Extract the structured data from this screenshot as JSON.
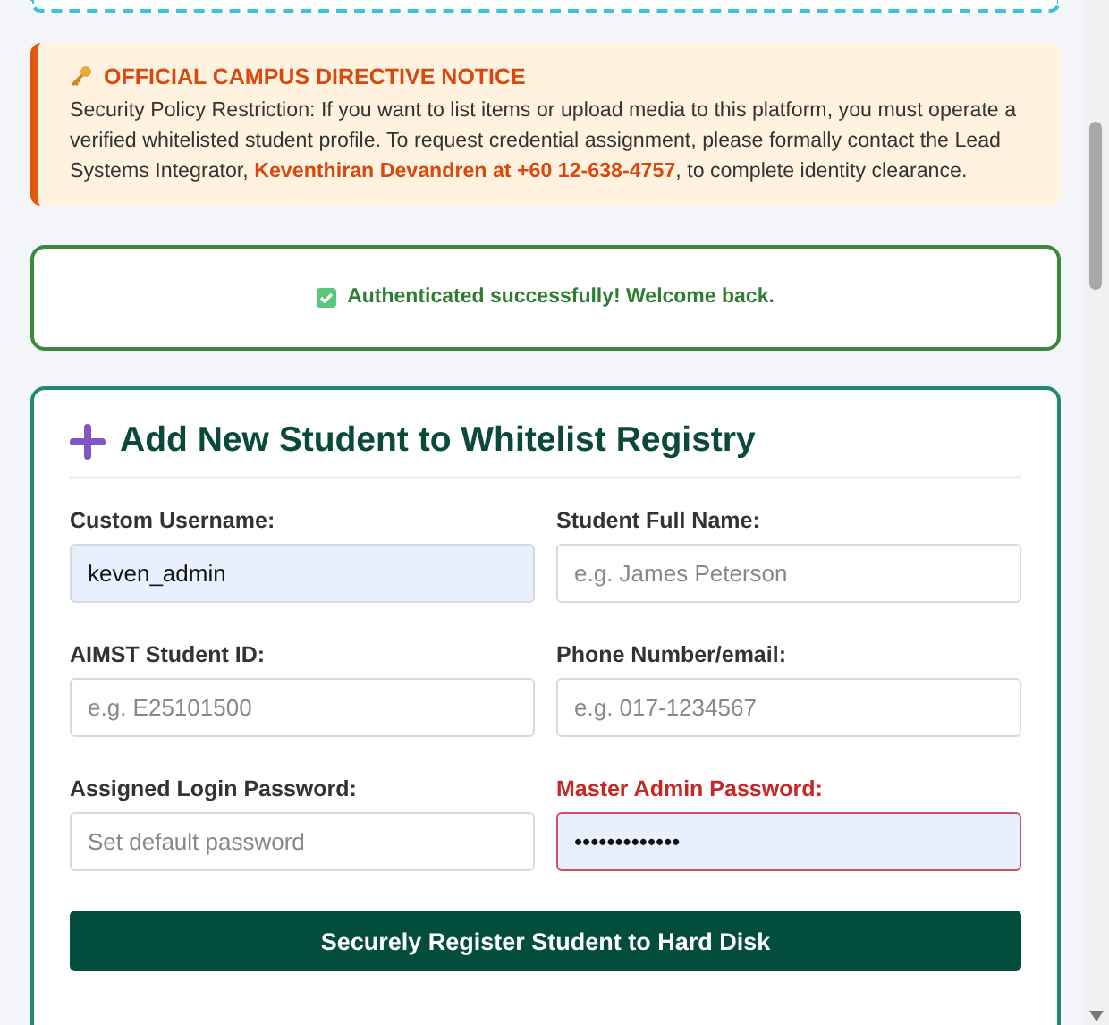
{
  "notice": {
    "title": "OFFICIAL CAMPUS DIRECTIVE NOTICE",
    "body": "Security Policy Restriction: If you want to list items or upload media to this platform, you must operate a verified whitelisted student profile. To request credential assignment, please formally contact the Lead Systems Integrator, **Keventhiran Devandren at +60 12-638-4757**, to complete identity clearance."
  },
  "status": {
    "message": "Authenticated successfully! Welcome back."
  },
  "form": {
    "title": "Add New Student to Whitelist Registry",
    "fields": [
      {
        "label": "Custom Username:",
        "value": "keven_admin",
        "autofilled": true,
        "alert": false
      },
      {
        "label": "Student Full Name:",
        "placeholder": "e.g. James Peterson",
        "autofilled": false,
        "alert": false
      },
      {
        "label": "AIMST Student ID:",
        "placeholder": "e.g. E25101500",
        "autofilled": false,
        "alert": false
      },
      {
        "label": "Phone Number/email:",
        "placeholder": "e.g. 017-1234567",
        "autofilled": false,
        "alert": false
      },
      {
        "label": "Assigned Login Password:",
        "placeholder": "Set default password",
        "autofilled": false,
        "alert": false
      },
      {
        "label": "Master Admin Password:",
        "value": "•••••••••••••",
        "autofilled": true,
        "alert": true
      }
    ],
    "submit": "Securely Register Student to Hard Disk"
  }
}
